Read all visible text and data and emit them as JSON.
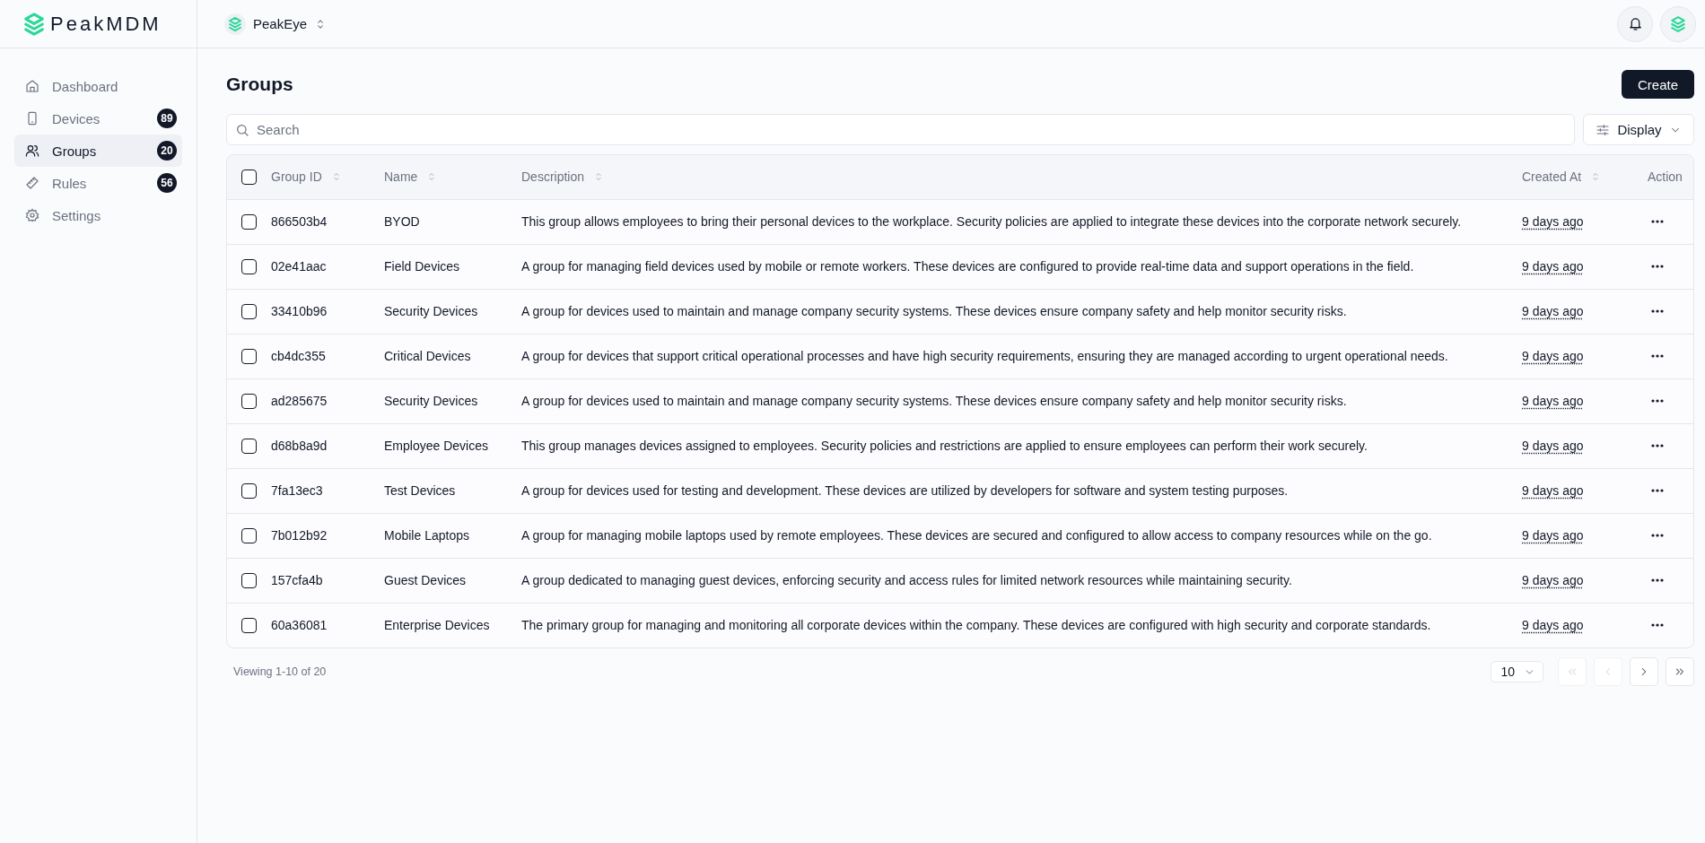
{
  "brand": {
    "name": "PeakMDM"
  },
  "workspace": {
    "name": "PeakEye"
  },
  "sidebar": {
    "items": [
      {
        "label": "Dashboard",
        "selected": false
      },
      {
        "label": "Devices",
        "count": "89",
        "selected": false
      },
      {
        "label": "Groups",
        "count": "20",
        "selected": true
      },
      {
        "label": "Rules",
        "count": "56",
        "selected": false
      },
      {
        "label": "Settings",
        "selected": false
      }
    ]
  },
  "page": {
    "title": "Groups",
    "create_button": "Create"
  },
  "search": {
    "placeholder": "Search"
  },
  "display_button": "Display",
  "table": {
    "select_all": {
      "checked": false
    },
    "columns": [
      {
        "label": "Group ID",
        "sortable": true
      },
      {
        "label": "Name",
        "sortable": true
      },
      {
        "label": "Description",
        "sortable": true
      },
      {
        "label": "Created At",
        "sortable": true
      },
      {
        "label": "Action",
        "sortable": false
      }
    ],
    "rows": [
      {
        "checked": false,
        "id": "866503b4",
        "name": "BYOD",
        "description": "This group allows employees to bring their personal devices to the workplace. Security policies are applied to integrate these devices into the corporate network securely.",
        "created": "9 days ago"
      },
      {
        "checked": false,
        "id": "02e41aac",
        "name": "Field Devices",
        "description": "A group for managing field devices used by mobile or remote workers. These devices are configured to provide real-time data and support operations in the field.",
        "created": "9 days ago"
      },
      {
        "checked": false,
        "id": "33410b96",
        "name": "Security Devices",
        "description": "A group for devices used to maintain and manage company security systems. These devices ensure company safety and help monitor security risks.",
        "created": "9 days ago"
      },
      {
        "checked": false,
        "id": "cb4dc355",
        "name": "Critical Devices",
        "description": "A group for devices that support critical operational processes and have high security requirements, ensuring they are managed according to urgent operational needs.",
        "created": "9 days ago"
      },
      {
        "checked": false,
        "id": "ad285675",
        "name": "Security Devices",
        "description": "A group for devices used to maintain and manage company security systems. These devices ensure company safety and help monitor security risks.",
        "created": "9 days ago"
      },
      {
        "checked": false,
        "id": "d68b8a9d",
        "name": "Employee Devices",
        "description": "This group manages devices assigned to employees. Security policies and restrictions are applied to ensure employees can perform their work securely.",
        "created": "9 days ago"
      },
      {
        "checked": false,
        "id": "7fa13ec3",
        "name": "Test Devices",
        "description": "A group for devices used for testing and development. These devices are utilized by developers for software and system testing purposes.",
        "created": "9 days ago"
      },
      {
        "checked": false,
        "id": "7b012b92",
        "name": "Mobile Laptops",
        "description": "A group for managing mobile laptops used by remote employees. These devices are secured and configured to allow access to company resources while on the go.",
        "created": "9 days ago"
      },
      {
        "checked": false,
        "id": "157cfa4b",
        "name": "Guest Devices",
        "description": "A group dedicated to managing guest devices, enforcing security and access rules for limited network resources while maintaining security.",
        "created": "9 days ago"
      },
      {
        "checked": false,
        "id": "60a36081",
        "name": "Enterprise Devices",
        "description": "The primary group for managing and monitoring all corporate devices within the company. These devices are configured with high security and corporate standards.",
        "created": "9 days ago"
      }
    ]
  },
  "footer": {
    "summary": "Viewing 1-10 of 20",
    "page_size": "10",
    "pager": [
      {
        "kind": "first",
        "disabled": true
      },
      {
        "kind": "prev",
        "disabled": true
      },
      {
        "kind": "next",
        "disabled": false
      },
      {
        "kind": "last",
        "disabled": false
      }
    ]
  }
}
